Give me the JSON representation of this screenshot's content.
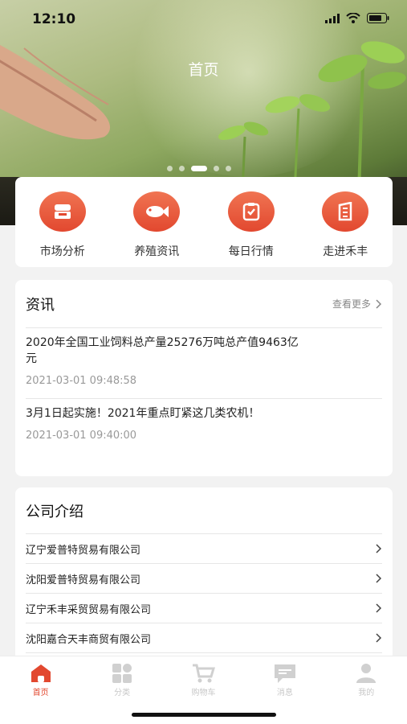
{
  "status_bar": {
    "time": "12:10"
  },
  "header": {
    "title": "首页"
  },
  "banner": {
    "slide_count": 5,
    "active_slide": 2
  },
  "quick_menu": [
    {
      "label": "市场分析",
      "icon": "market-icon"
    },
    {
      "label": "养殖资讯",
      "icon": "fish-icon"
    },
    {
      "label": "每日行情",
      "icon": "checklist-icon"
    },
    {
      "label": "走进禾丰",
      "icon": "building-icon"
    }
  ],
  "news": {
    "title": "资讯",
    "more": "查看更多",
    "items": [
      {
        "title": "2020年全国工业饲料总产量25276万吨总产值9463亿元",
        "date": "2021-03-01 09:48:58"
      },
      {
        "title": "3月1日起实施！2021年重点盯紧这几类农机！",
        "date": "2021-03-01 09:40:00"
      }
    ]
  },
  "company": {
    "title": "公司介绍",
    "items": [
      "辽宁爱普特贸易有限公司",
      "沈阳爱普特贸易有限公司",
      "辽宁禾丰采贸贸易有限公司",
      "沈阳嘉合天丰商贸有限公司"
    ]
  },
  "tabbar": [
    {
      "label": "首页",
      "icon": "home-icon",
      "active": true
    },
    {
      "label": "分类",
      "icon": "category-icon",
      "active": false
    },
    {
      "label": "购物车",
      "icon": "cart-icon",
      "active": false
    },
    {
      "label": "消息",
      "icon": "message-icon",
      "active": false
    },
    {
      "label": "我的",
      "icon": "profile-icon",
      "active": false
    }
  ],
  "colors": {
    "accent": "#e2482f",
    "inactive": "#c8c8c8"
  }
}
